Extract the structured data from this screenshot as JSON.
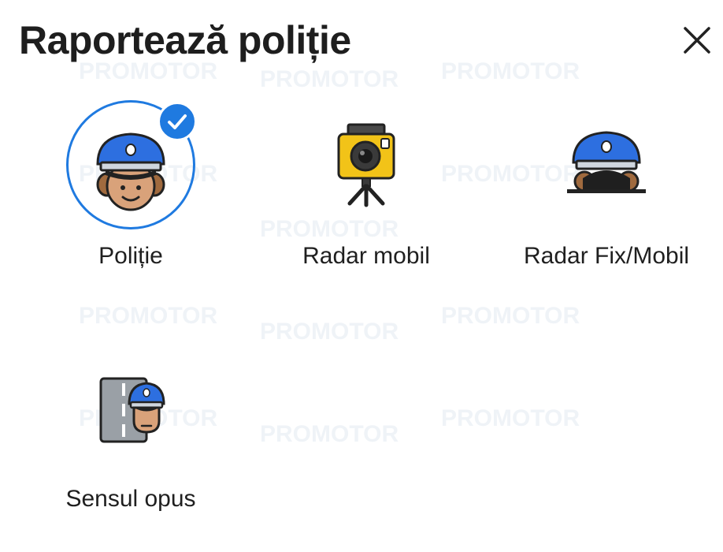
{
  "header": {
    "title": "Raportează poliție"
  },
  "options": [
    {
      "label": "Poliție",
      "icon": "police-officer-icon",
      "selected": true
    },
    {
      "label": "Radar mobil",
      "icon": "radar-camera-icon",
      "selected": false
    },
    {
      "label": "Radar Fix/Mobil",
      "icon": "hidden-police-icon",
      "selected": false
    },
    {
      "label": "Sensul opus",
      "icon": "police-opposite-lane-icon",
      "selected": false
    }
  ],
  "watermark": "PROMOTOR",
  "colors": {
    "accent": "#1f7ae0",
    "cap_blue": "#2d6fe0",
    "skin": "#d9a27a",
    "camera_yellow": "#f2c318",
    "text": "#1f1f1f"
  }
}
